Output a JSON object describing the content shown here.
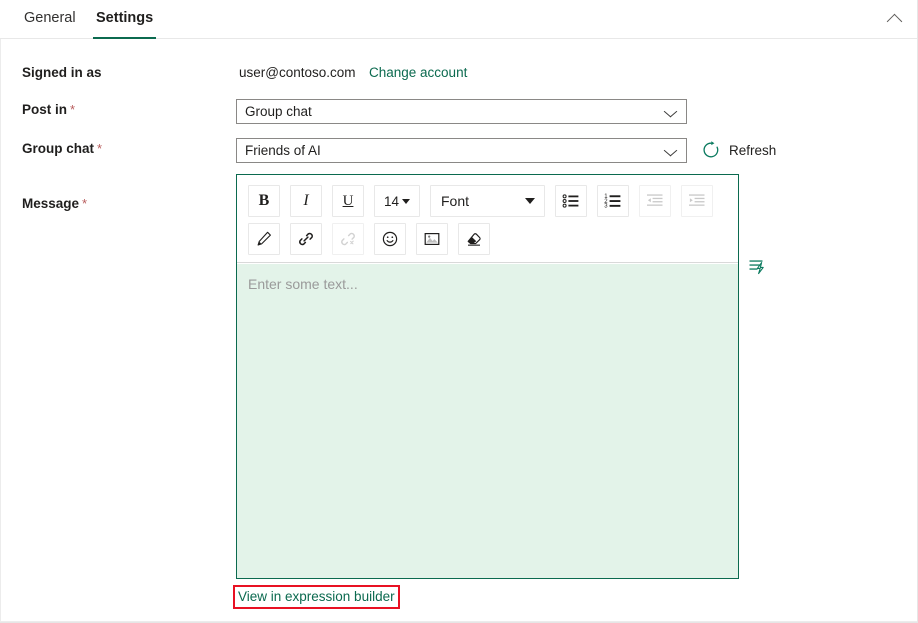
{
  "window": {
    "collapse_icon": "chevron-up-icon"
  },
  "tabs": [
    {
      "label": "General",
      "active": false
    },
    {
      "label": "Settings",
      "active": true
    }
  ],
  "form": {
    "signed_in": {
      "label": "Signed in as",
      "value": "user@contoso.com",
      "change_link": "Change account"
    },
    "post_in": {
      "label": "Post in",
      "required": "*",
      "value": "Group chat",
      "chevron_icon": "chevron-down-icon"
    },
    "group_chat": {
      "label": "Group chat",
      "required": "*",
      "value": "Friends of AI",
      "chevron_icon": "chevron-down-icon",
      "refresh_label": "Refresh",
      "refresh_icon": "refresh-circular-arrow-icon"
    },
    "message": {
      "label": "Message",
      "required": "*",
      "placeholder": "Enter some text...",
      "dynamic_content_icon": "lightning-bolt-icon",
      "expression_builder_link": "View in expression builder"
    }
  },
  "editor_toolbar": {
    "row1": [
      {
        "name": "bold",
        "label": "B",
        "icon": "bold-icon",
        "disabled": false
      },
      {
        "name": "italic",
        "label": "I",
        "icon": "italic-icon",
        "disabled": false
      },
      {
        "name": "underline",
        "label": "U",
        "icon": "underline-icon",
        "disabled": false
      },
      {
        "name": "font-size",
        "label": "14",
        "icon": "chevron-down-icon",
        "disabled": false
      },
      {
        "name": "font-family",
        "label": "Font",
        "icon": "chevron-down-icon",
        "disabled": false
      },
      {
        "name": "bulleted-list",
        "label": "",
        "icon": "bulleted-list-icon",
        "disabled": false
      },
      {
        "name": "numbered-list",
        "label": "",
        "icon": "numbered-list-icon",
        "disabled": false
      },
      {
        "name": "decrease-indent",
        "label": "",
        "icon": "decrease-indent-icon",
        "disabled": true
      },
      {
        "name": "increase-indent",
        "label": "",
        "icon": "increase-indent-icon",
        "disabled": true
      }
    ],
    "row2": [
      {
        "name": "text-color",
        "label": "",
        "icon": "pen-icon",
        "disabled": false
      },
      {
        "name": "insert-link",
        "label": "",
        "icon": "link-icon",
        "disabled": false
      },
      {
        "name": "remove-link",
        "label": "",
        "icon": "unlink-icon",
        "disabled": true
      },
      {
        "name": "insert-emoji",
        "label": "",
        "icon": "smiley-icon",
        "disabled": false
      },
      {
        "name": "insert-image",
        "label": "",
        "icon": "image-icon",
        "disabled": false
      },
      {
        "name": "clear-formatting",
        "label": "",
        "icon": "eraser-icon",
        "disabled": false
      }
    ]
  },
  "colors": {
    "accent": "#0b6a4f",
    "editor_background": "#e3f3e9",
    "highlight_box": "#e81123",
    "required_asterisk": "#b85c5c"
  }
}
